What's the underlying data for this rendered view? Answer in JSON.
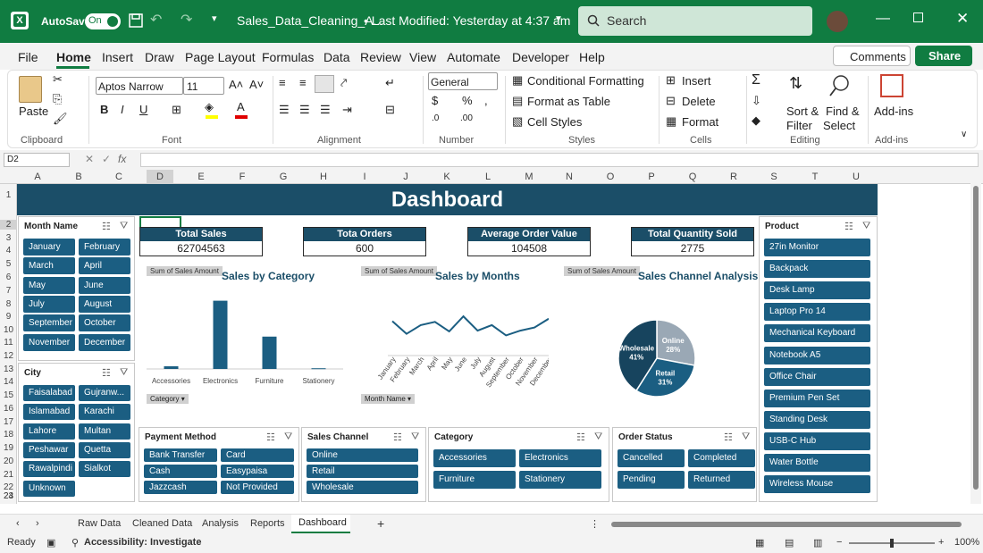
{
  "titlebar": {
    "autosave_label": "AutoSave",
    "autosave_state": "On",
    "filename": "Sales_Data_Cleaning_A...",
    "modified": "•  Last Modified: Yesterday at 4:37 am",
    "search_placeholder": "Search"
  },
  "menu": {
    "items": [
      "File",
      "Home",
      "Insert",
      "Draw",
      "Page Layout",
      "Formulas",
      "Data",
      "Review",
      "View",
      "Automate",
      "Developer",
      "Help"
    ],
    "active": "Home",
    "comments": "Comments",
    "share": "Share"
  },
  "ribbon": {
    "clipboard": {
      "paste": "Paste",
      "group": "Clipboard"
    },
    "font": {
      "name": "Aptos Narrow",
      "size": "11",
      "group": "Font"
    },
    "alignment": {
      "group": "Alignment"
    },
    "number": {
      "format": "General",
      "group": "Number"
    },
    "styles": {
      "conditional": "Conditional Formatting",
      "table": "Format as Table",
      "cell": "Cell Styles",
      "group": "Styles"
    },
    "cells": {
      "insert": "Insert",
      "delete": "Delete",
      "format": "Format",
      "group": "Cells"
    },
    "editing": {
      "sort": "Sort &",
      "filter": "Filter",
      "find": "Find &",
      "select": "Select",
      "group": "Editing"
    },
    "addins": {
      "label": "Add-ins",
      "group": "Add-ins"
    }
  },
  "formula_bar": {
    "name_box": "D2",
    "fx": "fx",
    "value": ""
  },
  "columns": [
    "A",
    "B",
    "C",
    "D",
    "E",
    "F",
    "G",
    "H",
    "I",
    "J",
    "K",
    "L",
    "M",
    "N",
    "O",
    "P",
    "Q",
    "R",
    "S",
    "T",
    "U"
  ],
  "rows": [
    "1",
    "2",
    "3",
    "4",
    "5",
    "6",
    "7",
    "8",
    "9",
    "10",
    "11",
    "12",
    "13",
    "14",
    "15",
    "16",
    "17",
    "18",
    "19",
    "20",
    "21",
    "22",
    "23",
    "24"
  ],
  "dashboard": {
    "title": "Dashboard",
    "kpis": [
      {
        "label": "Total Sales",
        "value": "62704563"
      },
      {
        "label": "Tota Orders",
        "value": "600"
      },
      {
        "label": "Average Order Value",
        "value": "104508"
      },
      {
        "label": "Total Quantity Sold",
        "value": "2775"
      }
    ],
    "slicers": {
      "month": {
        "title": "Month Name",
        "items": [
          "January",
          "February",
          "March",
          "April",
          "May",
          "June",
          "July",
          "August",
          "September",
          "October",
          "November",
          "December"
        ]
      },
      "city": {
        "title": "City",
        "items": [
          "Faisalabad",
          "Gujranw...",
          "Islamabad",
          "Karachi",
          "Lahore",
          "Multan",
          "Peshawar",
          "Quetta",
          "Rawalpindi",
          "Sialkot",
          "Unknown"
        ]
      },
      "product": {
        "title": "Product",
        "items": [
          "27in Monitor",
          "Backpack",
          "Desk Lamp",
          "Laptop Pro 14",
          "Mechanical Keyboard",
          "Notebook A5",
          "Office Chair",
          "Premium Pen Set",
          "Standing Desk",
          "USB-C Hub",
          "Water Bottle",
          "Wireless Mouse"
        ]
      },
      "payment": {
        "title": "Payment Method",
        "items": [
          "Bank Transfer",
          "Card",
          "Cash",
          "Easypaisa",
          "Jazzcash",
          "Not Provided"
        ]
      },
      "channel": {
        "title": "Sales Channel",
        "items": [
          "Online",
          "Retail",
          "Wholesale"
        ]
      },
      "category": {
        "title": "Category",
        "items": [
          "Accessories",
          "Electronics",
          "Furniture",
          "Stationery"
        ]
      },
      "status": {
        "title": "Order Status",
        "items": [
          "Cancelled",
          "Completed",
          "Pending",
          "Returned"
        ]
      }
    },
    "charts": {
      "sum_tag": "Sum of Sales Amount",
      "category_filter": "Category",
      "month_filter": "Month Name"
    }
  },
  "chart_data": [
    {
      "type": "bar",
      "title": "Sales by Category",
      "categories": [
        "Accessories",
        "Electronics",
        "Furniture",
        "Stationery"
      ],
      "values": [
        1.9,
        48.3,
        22.9,
        0.5
      ],
      "ylim": [
        0,
        55
      ],
      "grid": false,
      "legend": "none"
    },
    {
      "type": "line",
      "title": "Sales by Months",
      "categories": [
        "January",
        "February",
        "March",
        "April",
        "May",
        "June",
        "July",
        "August",
        "September",
        "October",
        "November",
        "December"
      ],
      "values": [
        5.8,
        4.2,
        5.3,
        5.7,
        4.5,
        6.4,
        4.6,
        5.3,
        4.0,
        4.6,
        5.0,
        6.1
      ],
      "ylim": [
        0,
        9
      ],
      "grid": false,
      "legend": "none"
    },
    {
      "type": "pie",
      "title": "Sales Channel Analysis",
      "categories": [
        "Online",
        "Retail",
        "Wholesale"
      ],
      "values": [
        28,
        31,
        41
      ],
      "labels": [
        "Online\n28%",
        "Retail\n31%",
        "Wholesale\n41%"
      ],
      "colors": [
        "#9aa8b5",
        "#1b5e82",
        "#17445e"
      ]
    }
  ],
  "sheet_tabs": {
    "items": [
      "Raw Data",
      "Cleaned Data",
      "Analysis",
      "Reports",
      "Dashboard"
    ],
    "active": "Dashboard"
  },
  "status": {
    "ready": "Ready",
    "accessibility": "Accessibility: Investigate",
    "zoom": "100%"
  }
}
